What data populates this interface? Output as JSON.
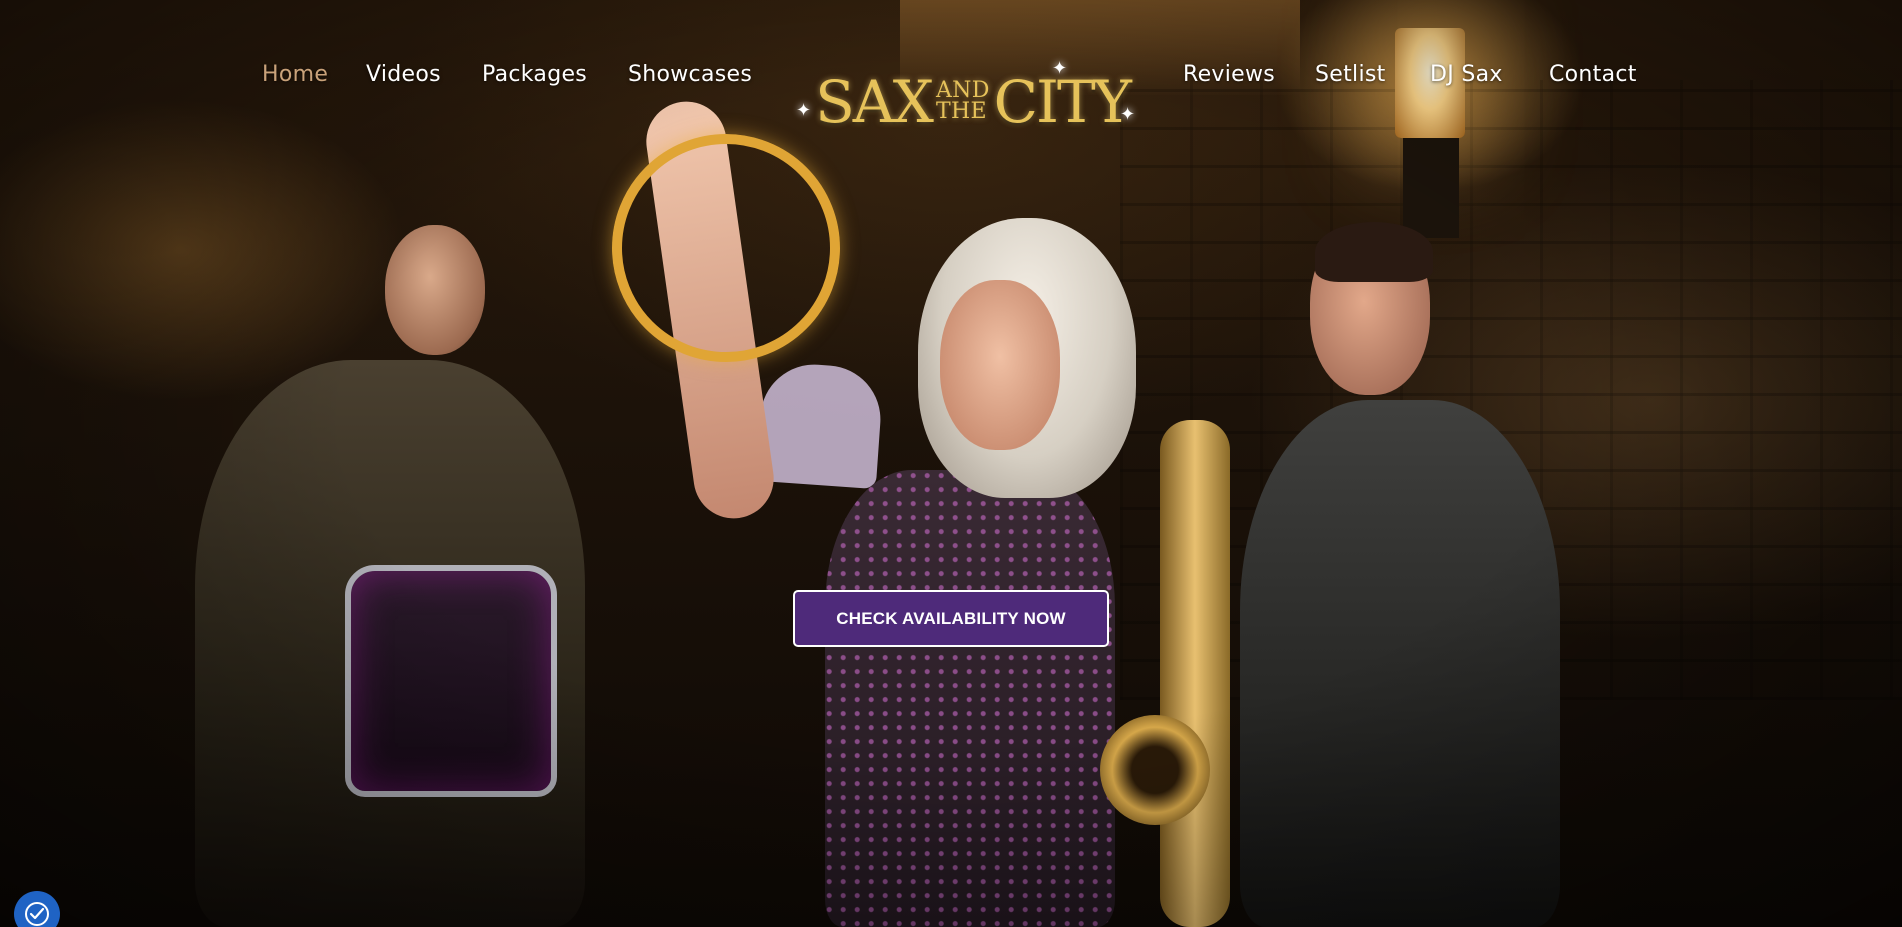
{
  "nav": {
    "left_items": [
      {
        "label": "Home",
        "active": true
      },
      {
        "label": "Videos"
      },
      {
        "label": "Packages"
      },
      {
        "label": "Showcases"
      }
    ],
    "right_items": [
      {
        "label": "Reviews"
      },
      {
        "label": "Setlist"
      },
      {
        "label": "DJ Sax"
      },
      {
        "label": "Contact"
      }
    ]
  },
  "logo": {
    "sax": "SAX",
    "and": "AND",
    "the": "THE",
    "city": "CITY"
  },
  "hero": {
    "cta_label": "CHECK AVAILABILITY NOW"
  },
  "colors": {
    "nav_active": "#c9a27a",
    "cta_background": "#4e2a7a",
    "logo_gold": "#e6c25a",
    "accessibility_blue": "#1f63c4"
  },
  "icons": {
    "accessibility": "accessibility-icon"
  }
}
